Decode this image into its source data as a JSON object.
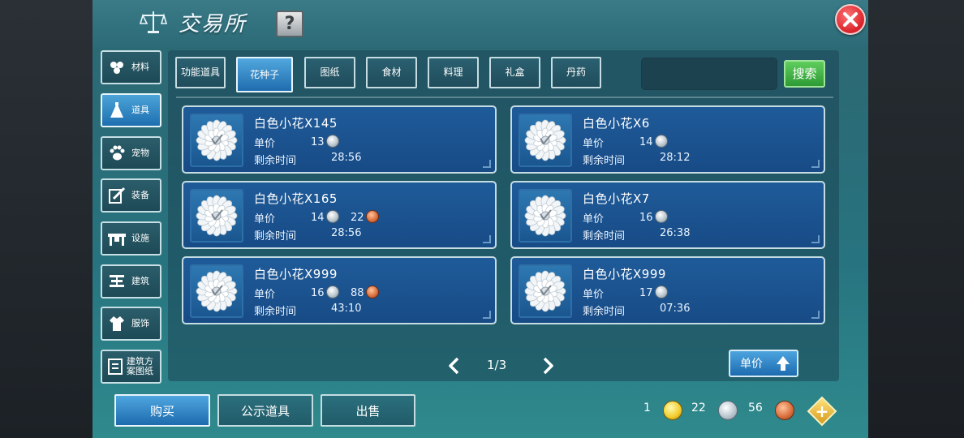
{
  "header": {
    "title": "交易所",
    "help_label": "?"
  },
  "sidebar": {
    "items": [
      {
        "label": "材料",
        "icon": "materials-icon"
      },
      {
        "label": "道具",
        "icon": "props-icon",
        "active": true
      },
      {
        "label": "宠物",
        "icon": "paw-icon"
      },
      {
        "label": "装备",
        "icon": "equipment-icon"
      },
      {
        "label": "设施",
        "icon": "facility-icon"
      },
      {
        "label": "建筑",
        "icon": "building-icon"
      },
      {
        "label": "服饰",
        "icon": "clothing-icon"
      },
      {
        "label": "建筑方案图纸",
        "icon": "blueprint-icon"
      }
    ]
  },
  "tabs": [
    {
      "label": "功能道具",
      "active": false
    },
    {
      "label": "花种子",
      "active": true
    },
    {
      "label": "图纸",
      "active": false
    },
    {
      "label": "食材",
      "active": false
    },
    {
      "label": "料理",
      "active": false
    },
    {
      "label": "礼盒",
      "active": false
    },
    {
      "label": "丹药",
      "active": false
    }
  ],
  "search": {
    "placeholder": "",
    "button_label": "搜索"
  },
  "listings": [
    {
      "name": "白色小花X145",
      "price_label": "单价",
      "silver": "13",
      "copper": "",
      "time_label": "剩余时间",
      "time": "28:56"
    },
    {
      "name": "白色小花X6",
      "price_label": "单价",
      "silver": "14",
      "copper": "",
      "time_label": "剩余时间",
      "time": "28:12"
    },
    {
      "name": "白色小花X165",
      "price_label": "单价",
      "silver": "14",
      "copper": "22",
      "time_label": "剩余时间",
      "time": "28:56"
    },
    {
      "name": "白色小花X7",
      "price_label": "单价",
      "silver": "16",
      "copper": "",
      "time_label": "剩余时间",
      "time": "26:38"
    },
    {
      "name": "白色小花X999",
      "price_label": "单价",
      "silver": "16",
      "copper": "88",
      "time_label": "剩余时间",
      "time": "43:10"
    },
    {
      "name": "白色小花X999",
      "price_label": "单价",
      "silver": "17",
      "copper": "",
      "time_label": "剩余时间",
      "time": "07:36"
    }
  ],
  "pager": {
    "text": "1/3"
  },
  "sort": {
    "label": "单价"
  },
  "bottom": {
    "buy_label": "购买",
    "public_label": "公示道具",
    "sell_label": "出售"
  },
  "wallet": {
    "gold": "1",
    "silver": "22",
    "copper": "56",
    "plus_label": "+"
  },
  "colors": {
    "accent": "#1d6bb0",
    "panel": "#2a6c77",
    "search": "#2d9a34",
    "close": "#d8222a"
  }
}
